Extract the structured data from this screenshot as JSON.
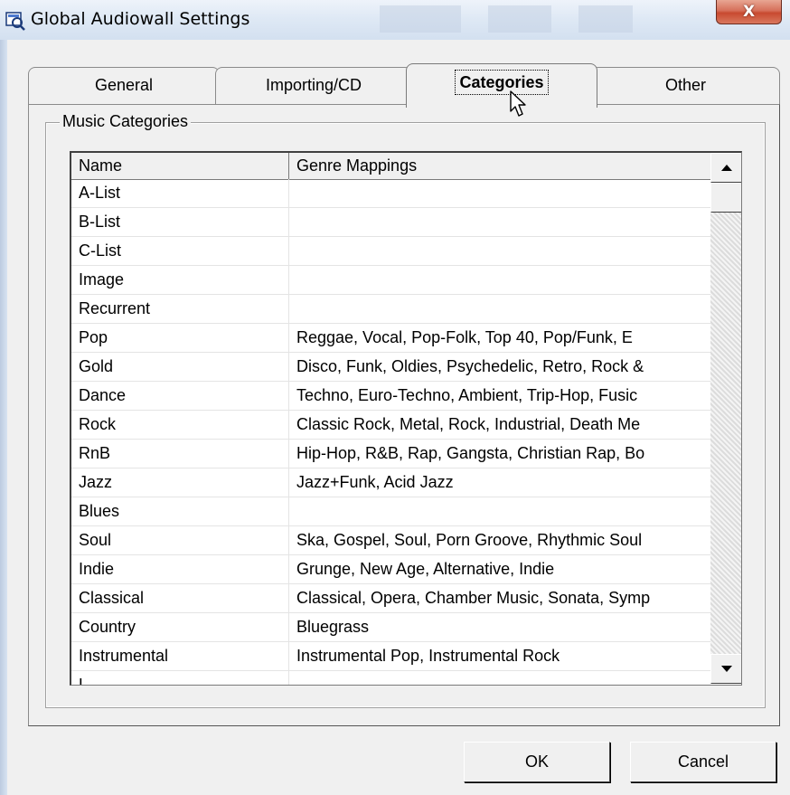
{
  "window": {
    "title": "Global Audiowall Settings",
    "close_symbol": "X",
    "icon": "audiowall-app-icon"
  },
  "tabs": [
    {
      "label": "General",
      "active": false
    },
    {
      "label": "Importing/CD",
      "active": false
    },
    {
      "label": "Categories",
      "active": true
    },
    {
      "label": "Other",
      "active": false
    }
  ],
  "group": {
    "label": "Music Categories"
  },
  "grid": {
    "columns": [
      "Name",
      "Genre Mappings"
    ],
    "rows": [
      {
        "name": "A-List",
        "genres": ""
      },
      {
        "name": "B-List",
        "genres": ""
      },
      {
        "name": "C-List",
        "genres": ""
      },
      {
        "name": "Image",
        "genres": ""
      },
      {
        "name": "Recurrent",
        "genres": ""
      },
      {
        "name": "Pop",
        "genres": "Reggae, Vocal, Pop-Folk, Top 40, Pop/Funk, E"
      },
      {
        "name": "Gold",
        "genres": "Disco, Funk, Oldies, Psychedelic, Retro, Rock &"
      },
      {
        "name": "Dance",
        "genres": "Techno, Euro-Techno, Ambient, Trip-Hop, Fusic"
      },
      {
        "name": "Rock",
        "genres": "Classic Rock, Metal, Rock, Industrial, Death Me"
      },
      {
        "name": "RnB",
        "genres": "Hip-Hop, R&B, Rap, Gangsta, Christian Rap, Bo"
      },
      {
        "name": "Jazz",
        "genres": "Jazz+Funk, Acid Jazz"
      },
      {
        "name": "Blues",
        "genres": ""
      },
      {
        "name": "Soul",
        "genres": "Ska, Gospel, Soul, Porn Groove, Rhythmic Soul"
      },
      {
        "name": "Indie",
        "genres": "Grunge, New Age, Alternative, Indie"
      },
      {
        "name": "Classical",
        "genres": "Classical, Opera, Chamber Music, Sonata, Symp"
      },
      {
        "name": "Country",
        "genres": "Bluegrass"
      },
      {
        "name": "Instrumental",
        "genres": "Instrumental Pop, Instrumental Rock"
      },
      {
        "name": "L",
        "genres": ""
      }
    ],
    "scroll_position": 0
  },
  "buttons": {
    "ok": "OK",
    "cancel": "Cancel"
  },
  "colors": {
    "close_button": "#c84a30",
    "dialog_background": "#f0f0f0",
    "grid_background": "#ffffff"
  }
}
